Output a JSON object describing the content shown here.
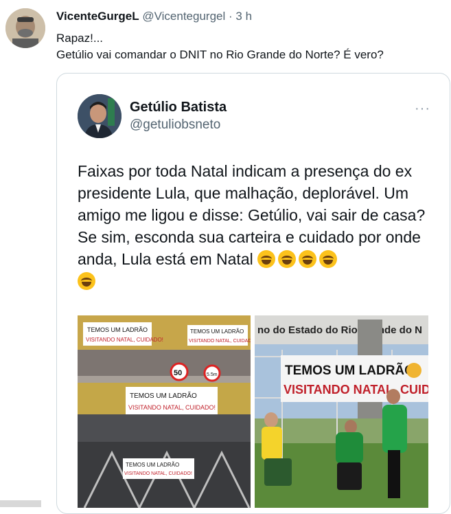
{
  "tweet": {
    "name": "VicenteGurgeL",
    "handle": "@Vicentegurgel",
    "separator": "·",
    "time": "3 h",
    "line1": "Rapaz!...",
    "line2": "Getúlio vai comandar o DNIT no Rio Grande do Norte? É vero?"
  },
  "quoted": {
    "name": "Getúlio Batista",
    "handle": "@getuliobsneto",
    "more": "···",
    "text": "Faixas por toda Natal indicam a presença do ex presidente Lula, que malhação, deplorável. Um amigo me ligou e disse: Getúlio, vai sair de casa? Se sim, esconda sua carteira e cuidado por onde anda, Lula está em Natal",
    "emoji_count": 5,
    "left_image": {
      "banner_line1": "TEMOS UM LADRÃO",
      "banner_line2": "VISITANDO NATAL, CUIDADO!",
      "sign_50": "50",
      "sign_55": "5.5m"
    },
    "right_image": {
      "building_text": "no do Estado do Rio Grande do N",
      "banner_line1": "TEMOS UM LADRÃO",
      "banner_line2": "VISITANDO NATAL, CUIDAD"
    }
  },
  "colors": {
    "text": "#0f1419",
    "secondary": "#536471",
    "border": "#cfd9de"
  }
}
